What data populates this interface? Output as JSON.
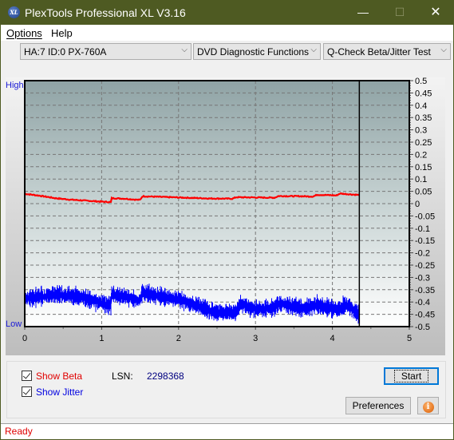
{
  "window": {
    "title": "PlexTools Professional XL V3.16",
    "app_icon": "XL",
    "controls": {
      "minimize": "—",
      "maximize": "☐",
      "close": "✕"
    }
  },
  "menu": {
    "items": [
      {
        "label": "Options",
        "accel": "O"
      },
      {
        "label": "Help",
        "accel": "H"
      }
    ]
  },
  "toolbar": {
    "drive_select": "HA:7 ID:0  PX-760A",
    "function_select": "DVD Diagnostic Functions",
    "test_select": "Q-Check Beta/Jitter Test",
    "dropdown_glyph": "⌵"
  },
  "chart_data": {
    "type": "line",
    "title": "",
    "xlabel": "",
    "ylabel_left_high": "High",
    "ylabel_left_low": "Low",
    "xlim": [
      0,
      5
    ],
    "ylim": [
      -0.5,
      0.5
    ],
    "x_ticks": [
      "0",
      "1",
      "2",
      "3",
      "4",
      "5"
    ],
    "y_ticks_right": [
      "0.5",
      "0.45",
      "0.4",
      "0.35",
      "0.3",
      "0.25",
      "0.2",
      "0.15",
      "0.1",
      "0.05",
      "0",
      "-0.05",
      "-0.1",
      "-0.15",
      "-0.2",
      "-0.25",
      "-0.3",
      "-0.35",
      "-0.4",
      "-0.45",
      "-0.5"
    ],
    "grid": true,
    "end_marker_x": 4.35,
    "series": [
      {
        "name": "Beta",
        "color": "#ff0000",
        "x": [
          0,
          0.2,
          0.4,
          0.6,
          0.8,
          1.0,
          1.12,
          1.13,
          1.3,
          1.45,
          1.5,
          1.53,
          1.8,
          2.1,
          2.4,
          2.7,
          2.75,
          3.0,
          3.25,
          3.3,
          3.6,
          3.75,
          3.8,
          4.0,
          4.05,
          4.1,
          4.35
        ],
        "values": [
          0.04,
          0.032,
          0.022,
          0.016,
          0.012,
          0.008,
          0.006,
          0.022,
          0.02,
          0.016,
          0.015,
          0.03,
          0.027,
          0.024,
          0.021,
          0.02,
          0.026,
          0.025,
          0.024,
          0.031,
          0.03,
          0.029,
          0.036,
          0.034,
          0.033,
          0.041,
          0.035
        ]
      },
      {
        "name": "Jitter",
        "color": "#0000ff",
        "x": [
          0,
          0.15,
          0.3,
          0.45,
          0.6,
          0.75,
          0.9,
          1.0,
          1.12,
          1.13,
          1.25,
          1.4,
          1.5,
          1.53,
          1.65,
          1.8,
          2.0,
          2.15,
          2.3,
          2.45,
          2.6,
          2.75,
          2.8,
          2.95,
          3.1,
          3.25,
          3.3,
          3.45,
          3.6,
          3.75,
          3.8,
          3.95,
          4.1,
          4.15,
          4.25,
          4.35
        ],
        "values": [
          -0.385,
          -0.38,
          -0.375,
          -0.37,
          -0.375,
          -0.38,
          -0.395,
          -0.405,
          -0.415,
          -0.37,
          -0.375,
          -0.385,
          -0.395,
          -0.36,
          -0.37,
          -0.38,
          -0.39,
          -0.405,
          -0.42,
          -0.44,
          -0.445,
          -0.44,
          -0.405,
          -0.425,
          -0.43,
          -0.425,
          -0.405,
          -0.415,
          -0.425,
          -0.42,
          -0.41,
          -0.425,
          -0.43,
          -0.41,
          -0.425,
          -0.455
        ]
      }
    ]
  },
  "controls": {
    "show_beta": {
      "label": "Show Beta",
      "checked": true,
      "color": "#e00000"
    },
    "show_jitter": {
      "label": "Show Jitter",
      "checked": true,
      "color": "#0000e0"
    },
    "lsn_label": "LSN:",
    "lsn_value": "2298368",
    "start_button": "Start",
    "preferences_button": "Preferences",
    "info_button": "i"
  },
  "status": {
    "text": "Ready"
  }
}
